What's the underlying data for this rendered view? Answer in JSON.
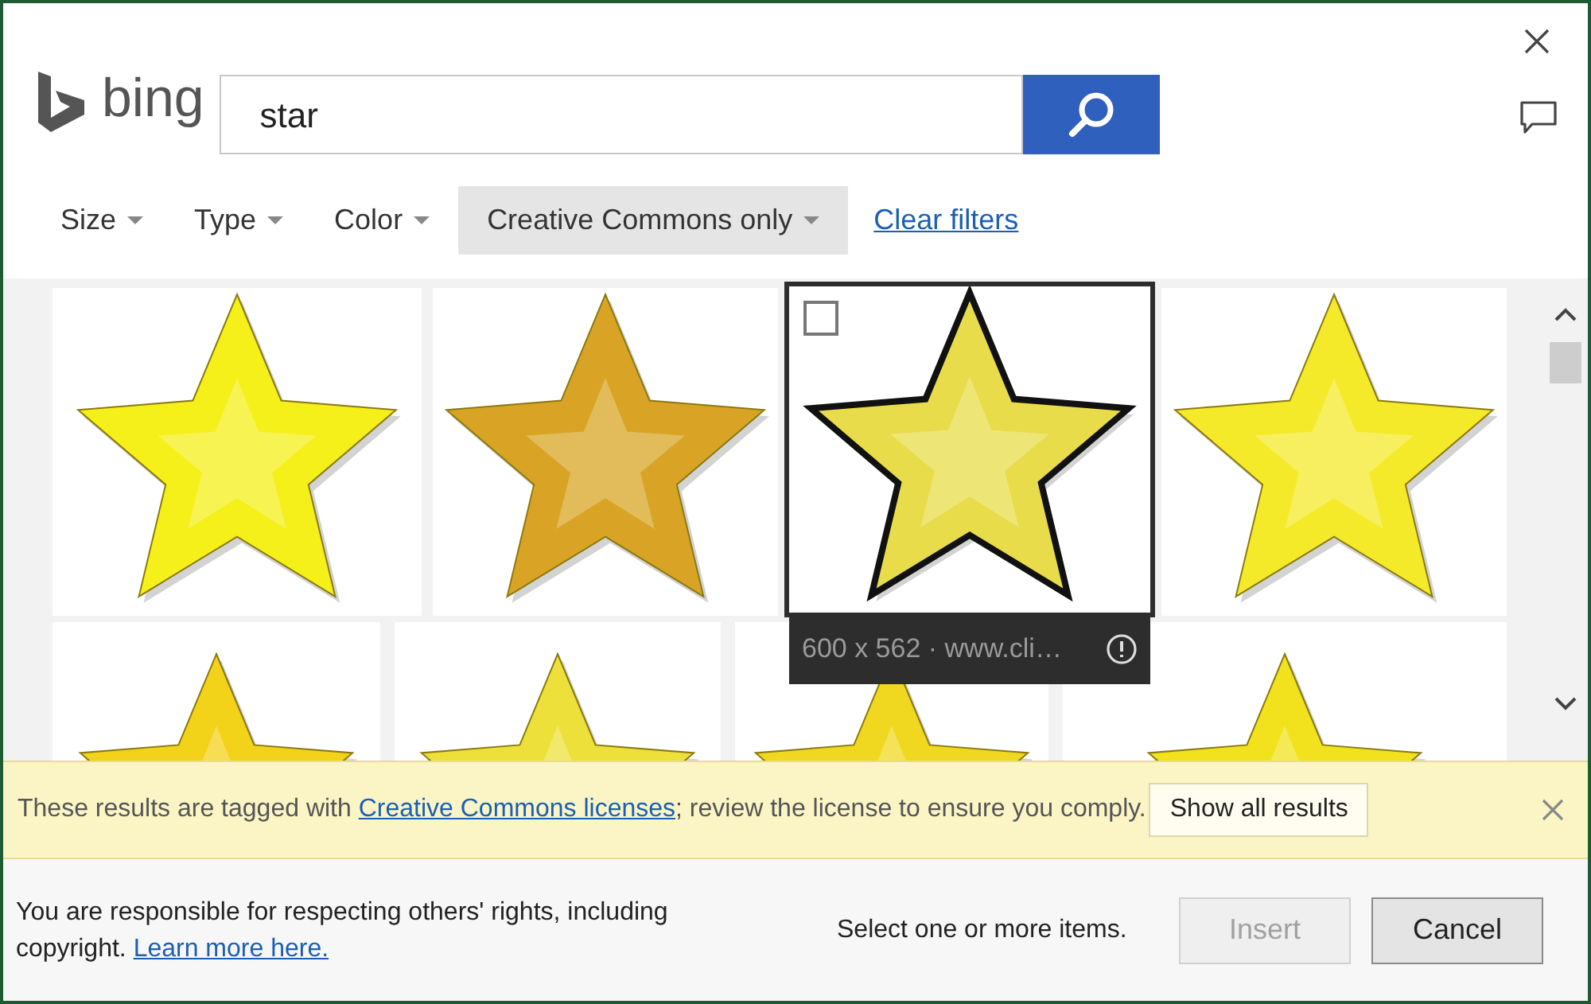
{
  "brand": "bing",
  "search": {
    "value": "star"
  },
  "filters": [
    {
      "label": "Size",
      "active": false
    },
    {
      "label": "Type",
      "active": false
    },
    {
      "label": "Color",
      "active": false
    },
    {
      "label": "Creative Commons only",
      "active": true
    }
  ],
  "clear_filters": "Clear filters",
  "images": [
    [
      {
        "kind": "picture"
      },
      {
        "kind": "picture"
      },
      {
        "kind": "picture",
        "hovered": true,
        "checked": false,
        "caption": "600 x 562 · www.cli…"
      },
      {
        "kind": "picture"
      }
    ],
    [
      {
        "kind": "picture"
      },
      {
        "kind": "picture"
      },
      {
        "kind": "picture"
      },
      {
        "kind": "picture"
      }
    ]
  ],
  "notice": {
    "text": "These results are tagged with ",
    "link": "Creative Commons licenses",
    "text_after": "; review the license to ensure you comply.",
    "button": "Show all results"
  },
  "footer": {
    "text": "You are responsible for respecting others' rights, including copyright. ",
    "link": "Learn more here.",
    "status": "Select one or more items."
  },
  "buttons": [
    {
      "label": "Insert",
      "disabled": true
    },
    {
      "label": "Cancel",
      "disabled": false
    }
  ]
}
